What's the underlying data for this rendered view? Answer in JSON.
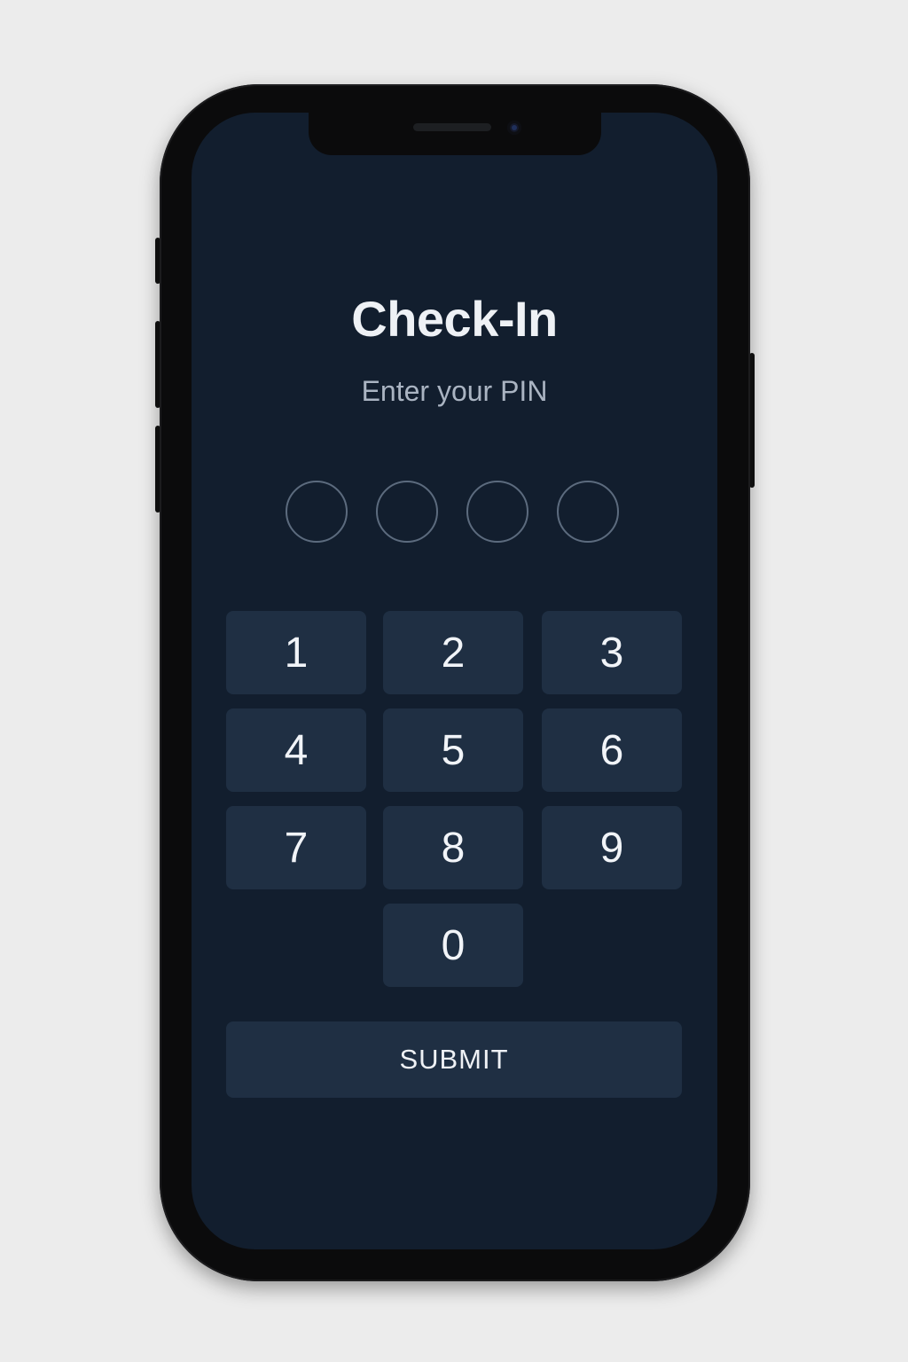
{
  "screen": {
    "title": "Check-In",
    "subtitle": "Enter your PIN"
  },
  "pin": {
    "length": 4,
    "filled": 0
  },
  "keypad": {
    "keys": [
      "1",
      "2",
      "3",
      "4",
      "5",
      "6",
      "7",
      "8",
      "9",
      "0"
    ]
  },
  "submit_label": "SUBMIT",
  "colors": {
    "page_background": "#ececec",
    "screen_background": "#121e2e",
    "key_background": "#1f2f43",
    "text_primary": "#eef1f5",
    "text_secondary": "#aab4c2",
    "pin_dot_border": "#5c6b7e"
  }
}
